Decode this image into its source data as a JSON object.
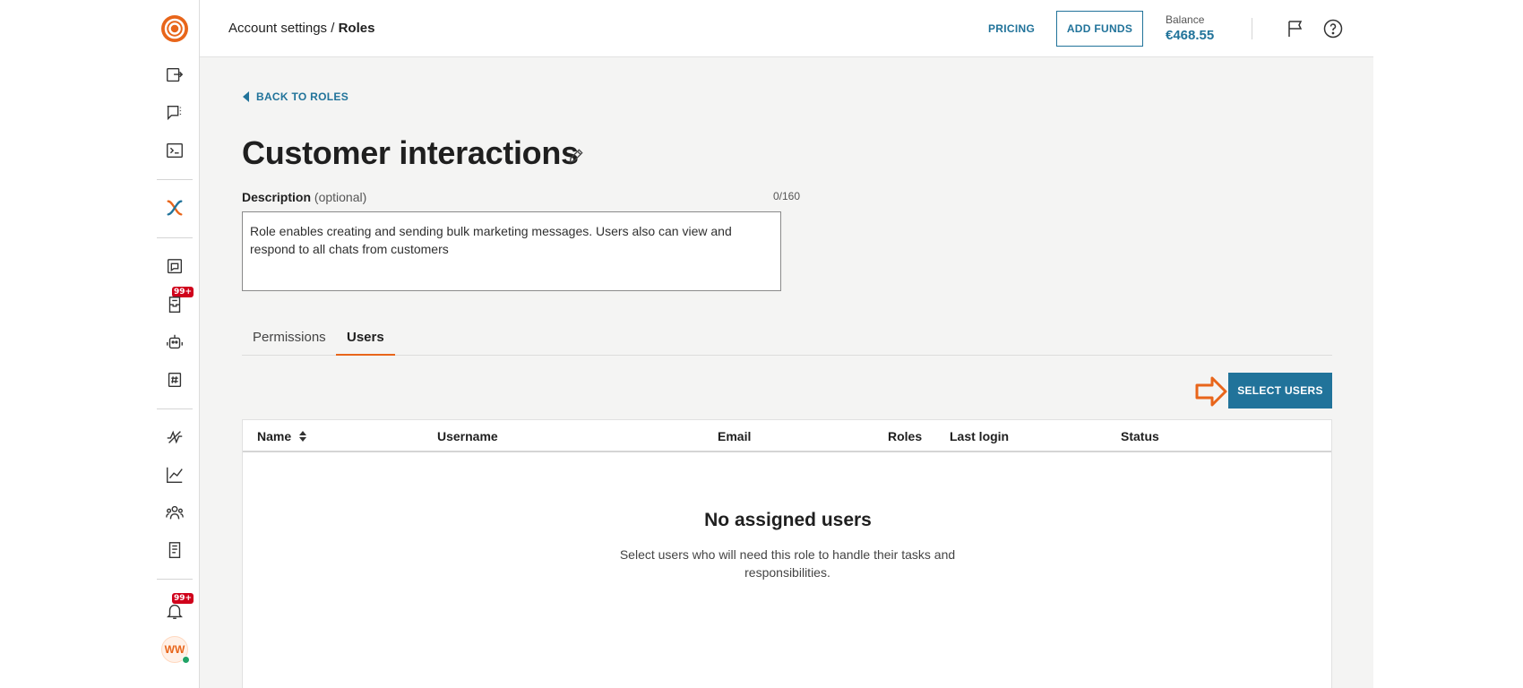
{
  "sidebar": {
    "badges": [
      "99+",
      "99+"
    ],
    "avatar_initials": "WW",
    "colors": {
      "accent": "#e8651a",
      "badge": "#d0021b",
      "online": "#21a366"
    }
  },
  "topbar": {
    "breadcrumb_parent": "Account settings /",
    "breadcrumb_current": "Roles",
    "pricing_label": "PRICING",
    "add_funds_label": "ADD FUNDS",
    "balance_label": "Balance",
    "balance_value": "€468.55"
  },
  "page": {
    "back_label": "BACK TO ROLES",
    "title": "Customer interactions",
    "description_label": "Description",
    "description_optional": "(optional)",
    "description_count": "0/160",
    "description_value": "Role enables creating and sending bulk marketing messages. Users also can view and respond to all chats from customers"
  },
  "tabs": [
    {
      "label": "Permissions",
      "active": false
    },
    {
      "label": "Users",
      "active": true
    }
  ],
  "select_users_label": "SELECT USERS",
  "table": {
    "columns": [
      "Name",
      "Username",
      "Email",
      "Roles",
      "Last login",
      "Status"
    ],
    "empty_title": "No assigned users",
    "empty_text": "Select users who will need this role to handle their tasks and responsibilities."
  },
  "colors": {
    "primary": "#21739a",
    "tab_underline": "#e8651a",
    "background": "#f4f4f3"
  }
}
